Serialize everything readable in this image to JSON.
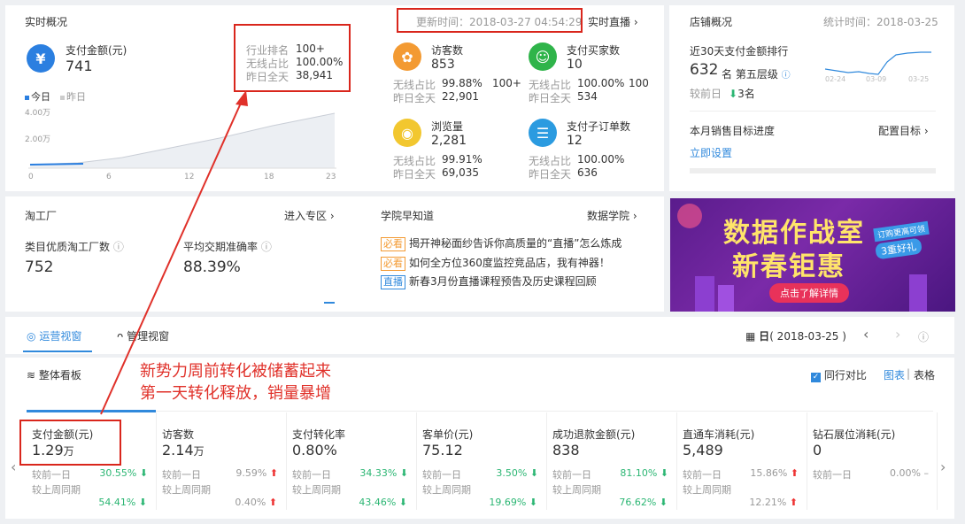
{
  "realtime": {
    "title": "实时概况",
    "updated": "更新时间：2018-03-27 04:54:29",
    "live_link": "实时直播",
    "pay_amount_label": "支付金额(元)",
    "pay_amount_value": "741",
    "rank_label": "行业排名",
    "rank_value": "100+",
    "wireless_label": "无线占比",
    "wireless_value": "100.00%",
    "yesterday_label": "昨日全天",
    "yesterday_value": "38,941",
    "legend_today": "今日",
    "legend_yesterday": "昨日",
    "y_ticks": [
      "4.00万",
      "2.00万"
    ],
    "x_ticks": [
      "0",
      "6",
      "12",
      "18",
      "23"
    ],
    "stats": [
      {
        "label": "访客数",
        "value": "853",
        "l1": "无线占比",
        "v1": "99.88%",
        "l2": "昨日全天",
        "v2": "22,901",
        "extra": "100+",
        "color": "#f39a32",
        "icon": "paw-icon"
      },
      {
        "label": "支付买家数",
        "value": "10",
        "l1": "无线占比",
        "v1": "100.00%",
        "l2": "昨日全天",
        "v2": "534",
        "extra": "100",
        "color": "#2fb44a",
        "icon": "user-icon"
      },
      {
        "label": "浏览量",
        "value": "2,281",
        "l1": "无线占比",
        "v1": "99.91%",
        "l2": "昨日全天",
        "v2": "69,035",
        "extra": "",
        "color": "#f2c72f",
        "icon": "eye-icon"
      },
      {
        "label": "支付子订单数",
        "value": "12",
        "l1": "无线占比",
        "v1": "100.00%",
        "l2": "昨日全天",
        "v2": "636",
        "extra": "",
        "color": "#2b9be0",
        "icon": "order-icon"
      }
    ]
  },
  "store": {
    "title": "店铺概况",
    "stat_time": "统计时间：2018-03-25",
    "rank_title": "近30天支付金额排行",
    "rank_value": "632",
    "rank_suffix": "名 第五层级",
    "compare": "较前日",
    "compare_value": "3名",
    "x_ticks": [
      "02-24",
      "03-09",
      "03-25"
    ],
    "target_title": "本月销售目标进度",
    "target_link": "配置目标",
    "set_now": "立即设置"
  },
  "taogongchang": {
    "title": "淘工厂",
    "enter": "进入专区",
    "factory_label": "类目优质淘工厂数",
    "factory_value": "752",
    "accuracy_label": "平均交期准确率",
    "accuracy_value": "88.39%"
  },
  "academy": {
    "title": "学院早知道",
    "link": "数据学院",
    "items": [
      {
        "tag": "必看",
        "text": "揭开神秘面纱告诉你高质量的“直播”怎么炼成"
      },
      {
        "tag": "必看",
        "text": "如何全方位360度监控竞品店，我有神器！"
      },
      {
        "tag": "直播",
        "text": "新春3月份直播课程预告及历史课程回顾"
      }
    ]
  },
  "banner": {
    "line1": "数据作战室",
    "line2": "新春钜惠",
    "badge1": "订购更高可领",
    "badge2": "3重好礼",
    "button": "点击了解详情"
  },
  "tabs": {
    "ops": "运营视窗",
    "mgmt": "管理视窗",
    "date_prefix": "日",
    "date": "( 2018-03-25 )"
  },
  "board": {
    "title": "整体看板",
    "peer_compare": "同行对比",
    "view_chart": "图表",
    "view_table": "表格"
  },
  "annotation": {
    "line1": "新势力周前转化被储蓄起来",
    "line2": "第一天转化释放，销量暴增"
  },
  "metrics": [
    {
      "title": "支付金额(元)",
      "value": "1.29",
      "unit": "万",
      "d1": "30.55%",
      "d1dir": "down",
      "w1": "54.41%",
      "w1dir": "down",
      "title_blue": true
    },
    {
      "title": "访客数",
      "value": "2.14",
      "unit": "万",
      "d1": "9.59%",
      "d1dir": "up",
      "w1": "0.40%",
      "w1dir": "up"
    },
    {
      "title": "支付转化率",
      "value": "0.80%",
      "unit": "",
      "d1": "34.33%",
      "d1dir": "down",
      "w1": "43.46%",
      "w1dir": "down"
    },
    {
      "title": "客单价(元)",
      "value": "75.12",
      "unit": "",
      "d1": "3.50%",
      "d1dir": "down",
      "w1": "19.69%",
      "w1dir": "down"
    },
    {
      "title": "成功退款金额(元)",
      "value": "838",
      "unit": "",
      "d1": "81.10%",
      "d1dir": "down",
      "w1": "76.62%",
      "w1dir": "down"
    },
    {
      "title": "直通车消耗(元)",
      "value": "5,489",
      "unit": "",
      "d1": "15.86%",
      "d1dir": "up",
      "w1": "12.21%",
      "w1dir": "up"
    },
    {
      "title": "钻石展位消耗(元)",
      "value": "0",
      "unit": "",
      "d1": "0.00%",
      "d1dir": "none",
      "w1": "",
      "w1dir": "none"
    }
  ],
  "metric_labels": {
    "day": "较前一日",
    "week": "较上周同期"
  }
}
